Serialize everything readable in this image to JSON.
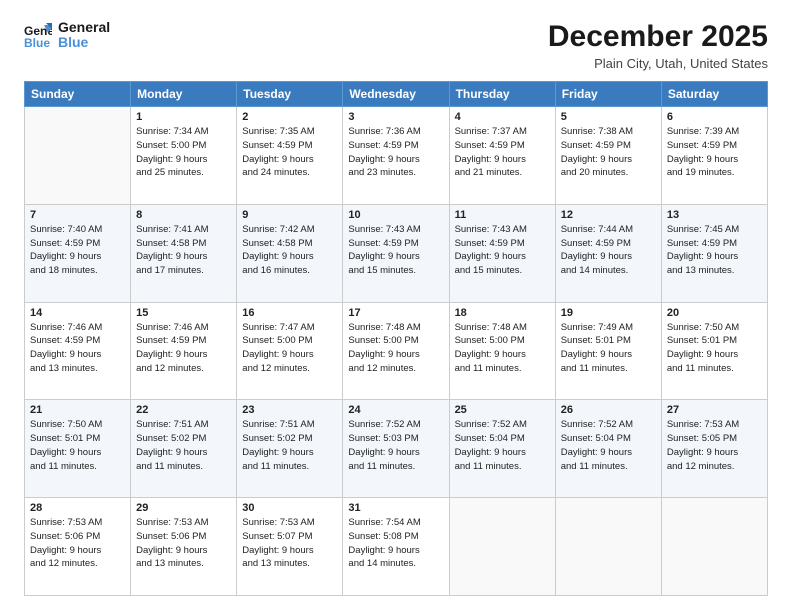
{
  "header": {
    "logo_line1": "General",
    "logo_line2": "Blue",
    "month": "December 2025",
    "location": "Plain City, Utah, United States"
  },
  "days_of_week": [
    "Sunday",
    "Monday",
    "Tuesday",
    "Wednesday",
    "Thursday",
    "Friday",
    "Saturday"
  ],
  "weeks": [
    [
      {
        "day": "",
        "info": ""
      },
      {
        "day": "1",
        "info": "Sunrise: 7:34 AM\nSunset: 5:00 PM\nDaylight: 9 hours\nand 25 minutes."
      },
      {
        "day": "2",
        "info": "Sunrise: 7:35 AM\nSunset: 4:59 PM\nDaylight: 9 hours\nand 24 minutes."
      },
      {
        "day": "3",
        "info": "Sunrise: 7:36 AM\nSunset: 4:59 PM\nDaylight: 9 hours\nand 23 minutes."
      },
      {
        "day": "4",
        "info": "Sunrise: 7:37 AM\nSunset: 4:59 PM\nDaylight: 9 hours\nand 21 minutes."
      },
      {
        "day": "5",
        "info": "Sunrise: 7:38 AM\nSunset: 4:59 PM\nDaylight: 9 hours\nand 20 minutes."
      },
      {
        "day": "6",
        "info": "Sunrise: 7:39 AM\nSunset: 4:59 PM\nDaylight: 9 hours\nand 19 minutes."
      }
    ],
    [
      {
        "day": "7",
        "info": "Sunrise: 7:40 AM\nSunset: 4:59 PM\nDaylight: 9 hours\nand 18 minutes."
      },
      {
        "day": "8",
        "info": "Sunrise: 7:41 AM\nSunset: 4:58 PM\nDaylight: 9 hours\nand 17 minutes."
      },
      {
        "day": "9",
        "info": "Sunrise: 7:42 AM\nSunset: 4:58 PM\nDaylight: 9 hours\nand 16 minutes."
      },
      {
        "day": "10",
        "info": "Sunrise: 7:43 AM\nSunset: 4:59 PM\nDaylight: 9 hours\nand 15 minutes."
      },
      {
        "day": "11",
        "info": "Sunrise: 7:43 AM\nSunset: 4:59 PM\nDaylight: 9 hours\nand 15 minutes."
      },
      {
        "day": "12",
        "info": "Sunrise: 7:44 AM\nSunset: 4:59 PM\nDaylight: 9 hours\nand 14 minutes."
      },
      {
        "day": "13",
        "info": "Sunrise: 7:45 AM\nSunset: 4:59 PM\nDaylight: 9 hours\nand 13 minutes."
      }
    ],
    [
      {
        "day": "14",
        "info": "Sunrise: 7:46 AM\nSunset: 4:59 PM\nDaylight: 9 hours\nand 13 minutes."
      },
      {
        "day": "15",
        "info": "Sunrise: 7:46 AM\nSunset: 4:59 PM\nDaylight: 9 hours\nand 12 minutes."
      },
      {
        "day": "16",
        "info": "Sunrise: 7:47 AM\nSunset: 5:00 PM\nDaylight: 9 hours\nand 12 minutes."
      },
      {
        "day": "17",
        "info": "Sunrise: 7:48 AM\nSunset: 5:00 PM\nDaylight: 9 hours\nand 12 minutes."
      },
      {
        "day": "18",
        "info": "Sunrise: 7:48 AM\nSunset: 5:00 PM\nDaylight: 9 hours\nand 11 minutes."
      },
      {
        "day": "19",
        "info": "Sunrise: 7:49 AM\nSunset: 5:01 PM\nDaylight: 9 hours\nand 11 minutes."
      },
      {
        "day": "20",
        "info": "Sunrise: 7:50 AM\nSunset: 5:01 PM\nDaylight: 9 hours\nand 11 minutes."
      }
    ],
    [
      {
        "day": "21",
        "info": "Sunrise: 7:50 AM\nSunset: 5:01 PM\nDaylight: 9 hours\nand 11 minutes."
      },
      {
        "day": "22",
        "info": "Sunrise: 7:51 AM\nSunset: 5:02 PM\nDaylight: 9 hours\nand 11 minutes."
      },
      {
        "day": "23",
        "info": "Sunrise: 7:51 AM\nSunset: 5:02 PM\nDaylight: 9 hours\nand 11 minutes."
      },
      {
        "day": "24",
        "info": "Sunrise: 7:52 AM\nSunset: 5:03 PM\nDaylight: 9 hours\nand 11 minutes."
      },
      {
        "day": "25",
        "info": "Sunrise: 7:52 AM\nSunset: 5:04 PM\nDaylight: 9 hours\nand 11 minutes."
      },
      {
        "day": "26",
        "info": "Sunrise: 7:52 AM\nSunset: 5:04 PM\nDaylight: 9 hours\nand 11 minutes."
      },
      {
        "day": "27",
        "info": "Sunrise: 7:53 AM\nSunset: 5:05 PM\nDaylight: 9 hours\nand 12 minutes."
      }
    ],
    [
      {
        "day": "28",
        "info": "Sunrise: 7:53 AM\nSunset: 5:06 PM\nDaylight: 9 hours\nand 12 minutes."
      },
      {
        "day": "29",
        "info": "Sunrise: 7:53 AM\nSunset: 5:06 PM\nDaylight: 9 hours\nand 13 minutes."
      },
      {
        "day": "30",
        "info": "Sunrise: 7:53 AM\nSunset: 5:07 PM\nDaylight: 9 hours\nand 13 minutes."
      },
      {
        "day": "31",
        "info": "Sunrise: 7:54 AM\nSunset: 5:08 PM\nDaylight: 9 hours\nand 14 minutes."
      },
      {
        "day": "",
        "info": ""
      },
      {
        "day": "",
        "info": ""
      },
      {
        "day": "",
        "info": ""
      }
    ]
  ]
}
